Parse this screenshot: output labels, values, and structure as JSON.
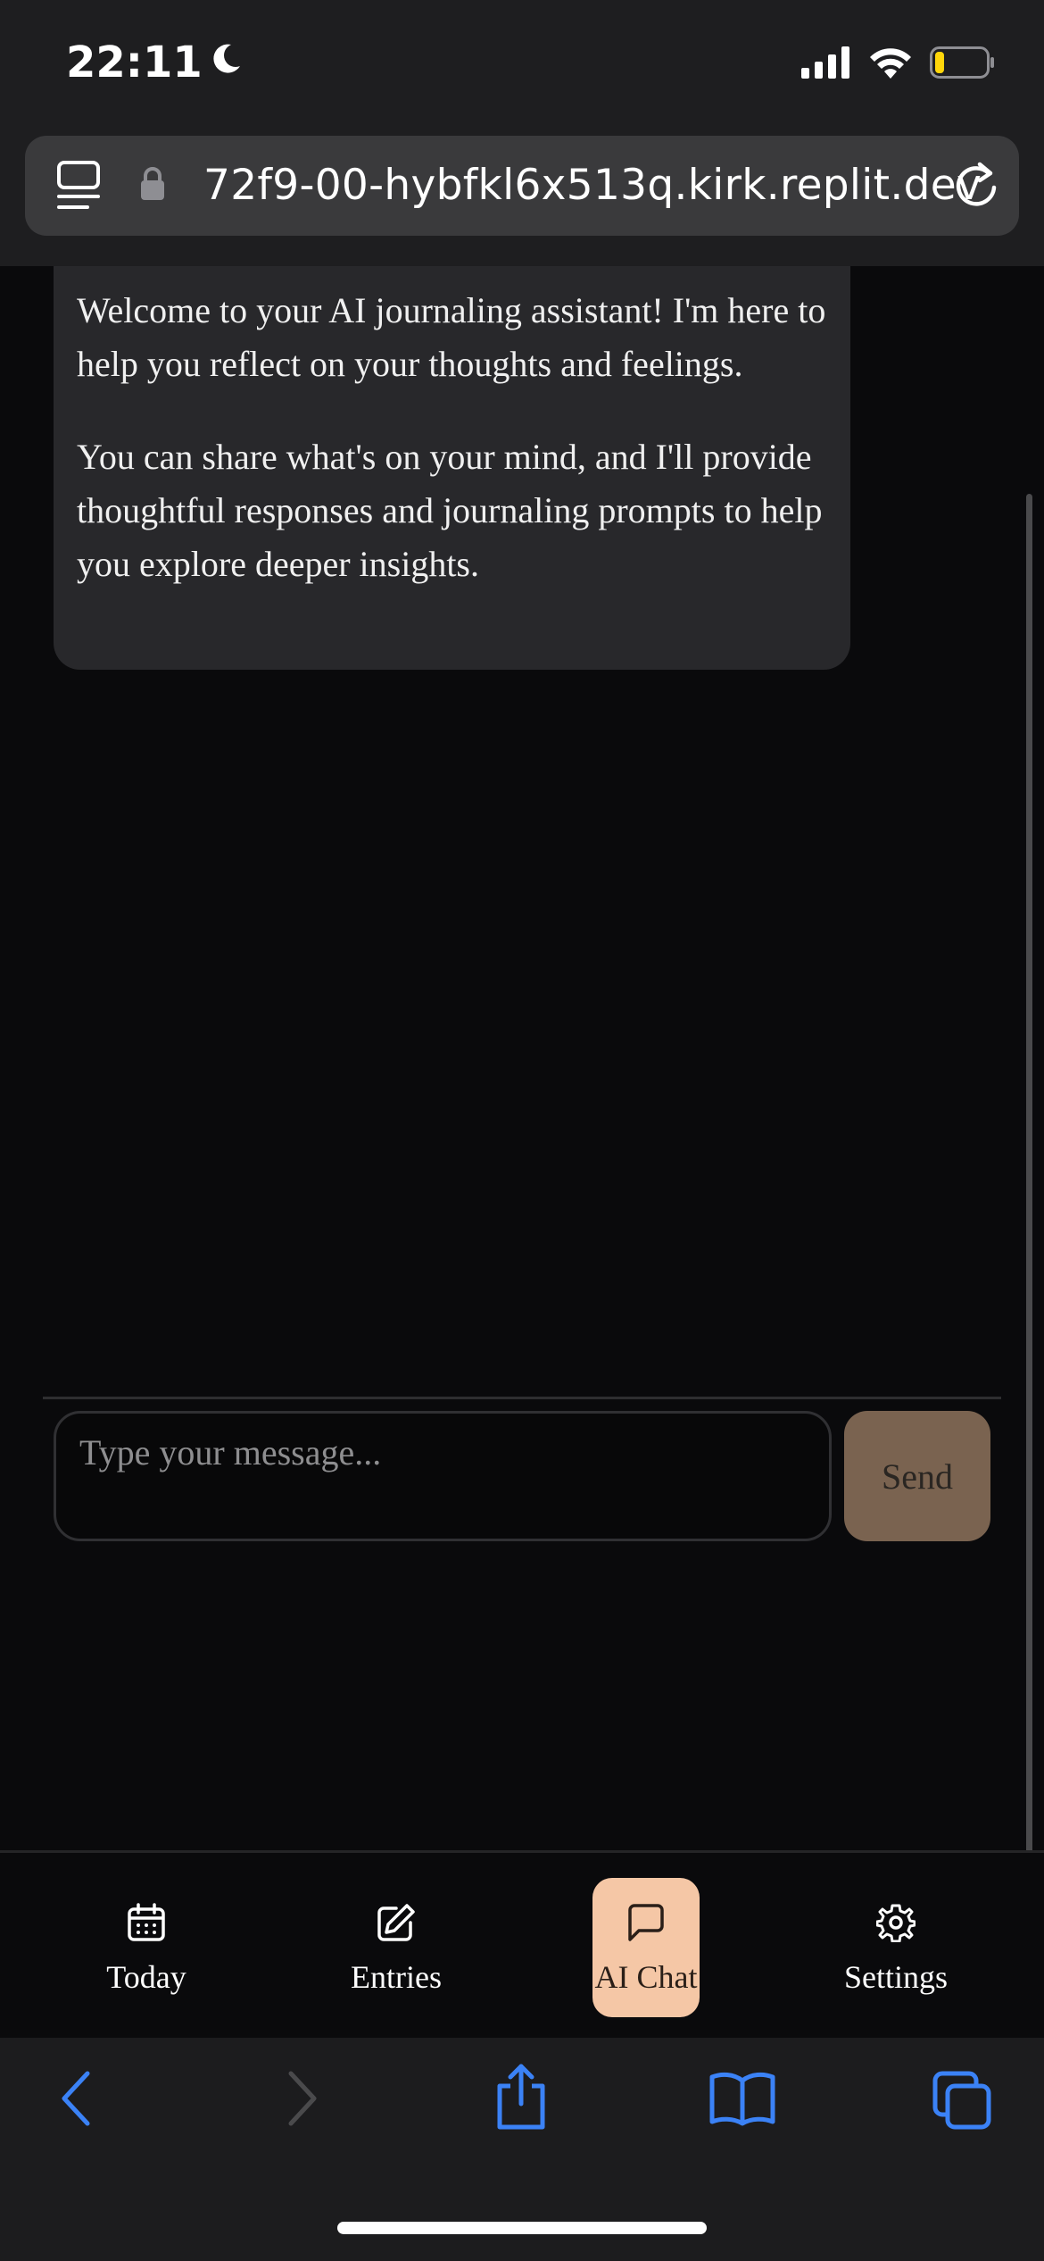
{
  "status": {
    "time": "22:11"
  },
  "browser": {
    "url": "72f9-00-hybfkl6x513q.kirk.replit.dev"
  },
  "chat": {
    "messages": [
      {
        "role": "assistant",
        "paragraphs": [
          "Welcome to your AI journaling assistant! I'm here to help you reflect on your thoughts and feelings.",
          "You can share what's on your mind, and I'll provide thoughtful responses and journaling prompts to help you explore deeper insights."
        ]
      }
    ],
    "input_placeholder": "Type your message...",
    "send_label": "Send"
  },
  "nav": {
    "items": [
      {
        "label": "Today",
        "icon": "calendar-icon"
      },
      {
        "label": "Entries",
        "icon": "edit-icon"
      },
      {
        "label": "AI Chat",
        "icon": "message-icon",
        "active": true
      },
      {
        "label": "Settings",
        "icon": "gear-icon"
      }
    ]
  },
  "colors": {
    "background": "#0a0a0c",
    "bubble": "#28282b",
    "accent": "#f5c7a6",
    "send_button": "#7a6350",
    "safari_blue": "#3b82f6"
  }
}
